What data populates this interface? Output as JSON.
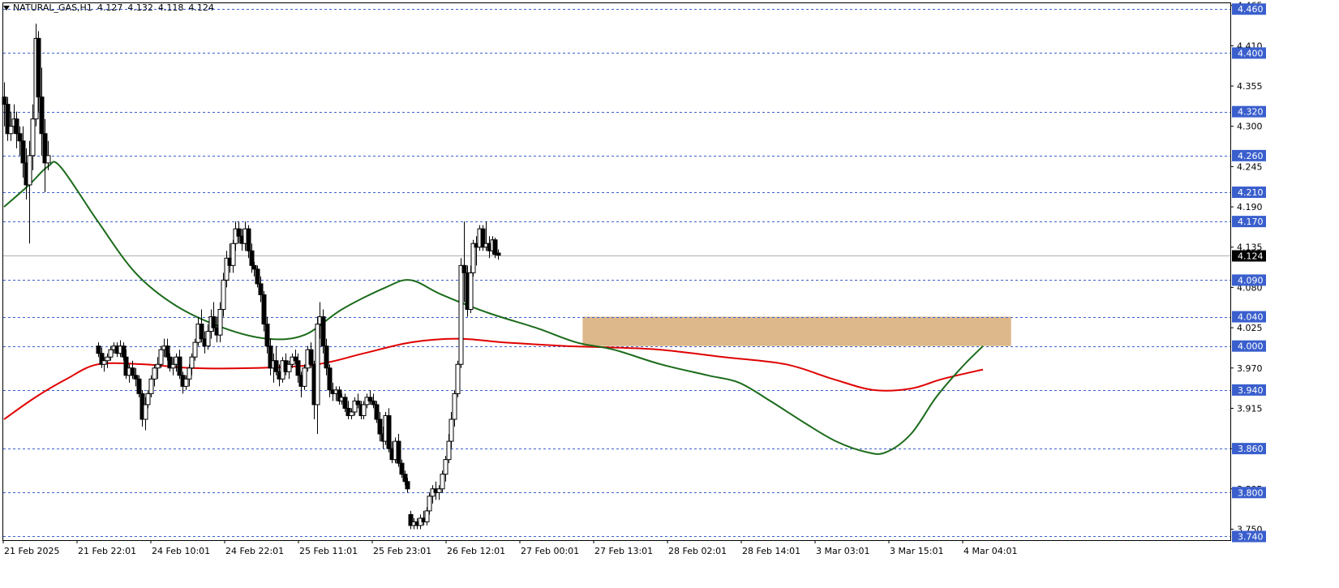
{
  "header": {
    "symbol": "NATURAL_GAS,H1",
    "open": "4.127",
    "high": "4.132",
    "low": "4.118",
    "close": "4.124"
  },
  "colors": {
    "background": "#ffffff",
    "bull": "#ffffff",
    "bear": "#000000",
    "ma_fast": "#1b6b1b",
    "ma_slow": "#e00000",
    "zone": "#dcb88a",
    "level_line": "#3a5fcd",
    "level_label_bg": "#3a5fcd",
    "current_price_bg": "#000000"
  },
  "chart_data": {
    "type": "candlestick",
    "ylim": [
      3.735,
      4.468
    ],
    "grid": false,
    "y_ticks": [
      "4.465",
      "4.410",
      "4.355",
      "4.300",
      "4.245",
      "4.190",
      "4.135",
      "4.080",
      "4.025",
      "3.970",
      "3.915",
      "3.860",
      "3.805",
      "3.750"
    ],
    "x_ticks": [
      "21 Feb 2025",
      "21 Feb 22:01",
      "24 Feb 10:01",
      "24 Feb 22:01",
      "25 Feb 11:01",
      "25 Feb 23:01",
      "26 Feb 12:01",
      "27 Feb 00:01",
      "27 Feb 13:01",
      "28 Feb 02:01",
      "28 Feb 14:01",
      "3 Mar 03:01",
      "3 Mar 15:01",
      "4 Mar 04:01"
    ],
    "levels": [
      {
        "value": 4.46,
        "label": "4.460"
      },
      {
        "value": 4.4,
        "label": "4.400"
      },
      {
        "value": 4.32,
        "label": "4.320"
      },
      {
        "value": 4.26,
        "label": "4.260"
      },
      {
        "value": 4.21,
        "label": "4.210"
      },
      {
        "value": 4.17,
        "label": "4.170"
      },
      {
        "value": 4.09,
        "label": "4.090"
      },
      {
        "value": 4.04,
        "label": "4.040"
      },
      {
        "value": 4.0,
        "label": "4.000"
      },
      {
        "value": 3.94,
        "label": "3.940"
      },
      {
        "value": 3.86,
        "label": "3.860"
      },
      {
        "value": 3.8,
        "label": "3.800"
      },
      {
        "value": 3.74,
        "label": "3.740"
      }
    ],
    "current_price": {
      "value": 4.124,
      "label": "4.124"
    },
    "zone": {
      "from_bar": 185,
      "to_bar": 322,
      "low": 4.0,
      "high": 4.04
    },
    "candles": [
      [
        4.34,
        4.36,
        4.3,
        4.33
      ],
      [
        4.33,
        4.34,
        4.28,
        4.29
      ],
      [
        4.29,
        4.32,
        4.28,
        4.3
      ],
      [
        4.3,
        4.33,
        4.29,
        4.31
      ],
      [
        4.31,
        4.32,
        4.27,
        4.29
      ],
      [
        4.29,
        4.3,
        4.26,
        4.28
      ],
      [
        4.28,
        4.3,
        4.23,
        4.25
      ],
      [
        4.25,
        4.27,
        4.2,
        4.22
      ],
      [
        4.22,
        4.28,
        4.14,
        4.26
      ],
      [
        4.26,
        4.33,
        4.24,
        4.31
      ],
      [
        4.31,
        4.44,
        4.3,
        4.42
      ],
      [
        4.42,
        4.43,
        4.32,
        4.34
      ],
      [
        4.34,
        4.38,
        4.26,
        4.29
      ],
      [
        4.29,
        4.31,
        4.21,
        4.25
      ],
      [
        4.25,
        4.28,
        4.24,
        4.26
      ],
      [
        4.26,
        4.28,
        4.25,
        4.27
      ],
      [
        4.27,
        4.28,
        4.25,
        4.26
      ],
      [
        4.26,
        4.27,
        4.24,
        4.25
      ],
      [
        4.25,
        4.26,
        4.24,
        4.25
      ],
      [
        4.25,
        4.26,
        4.24,
        4.25
      ],
      [
        4.25,
        4.26,
        4.24,
        4.25
      ],
      [
        4.25,
        4.26,
        4.24,
        4.25
      ],
      [
        4.25,
        4.26,
        4.24,
        4.25
      ],
      [
        4.25,
        4.26,
        4.24,
        4.25
      ],
      [
        4.25,
        4.26,
        4.24,
        4.25
      ],
      [
        4.25,
        4.26,
        4.24,
        4.25
      ],
      [
        4.25,
        4.26,
        4.24,
        4.25
      ],
      [
        4.25,
        4.26,
        4.24,
        4.25
      ],
      [
        4.25,
        4.26,
        4.24,
        4.25
      ],
      [
        4.25,
        4.26,
        4.24,
        4.25
      ],
      [
        4.0,
        4.005,
        3.985,
        3.99
      ],
      [
        3.99,
        3.998,
        3.97,
        3.975
      ],
      [
        3.975,
        3.985,
        3.965,
        3.98
      ],
      [
        3.98,
        3.99,
        3.97,
        3.985
      ],
      [
        3.985,
        4.0,
        3.98,
        3.995
      ],
      [
        3.995,
        4.005,
        3.99,
        4.0
      ],
      [
        4.0,
        4.005,
        3.985,
        3.99
      ],
      [
        3.99,
        4.008,
        3.985,
        4.0
      ],
      [
        4.0,
        4.005,
        3.98,
        3.985
      ],
      [
        3.985,
        3.995,
        3.955,
        3.96
      ],
      [
        3.96,
        3.975,
        3.95,
        3.97
      ],
      [
        3.97,
        3.98,
        3.955,
        3.96
      ],
      [
        3.96,
        3.97,
        3.945,
        3.955
      ],
      [
        3.955,
        3.96,
        3.93,
        3.935
      ],
      [
        3.935,
        3.94,
        3.89,
        3.9
      ],
      [
        3.9,
        3.93,
        3.885,
        3.92
      ],
      [
        3.92,
        3.94,
        3.915,
        3.935
      ],
      [
        3.935,
        3.96,
        3.93,
        3.955
      ],
      [
        3.955,
        3.975,
        3.945,
        3.97
      ],
      [
        3.97,
        3.985,
        3.955,
        3.975
      ],
      [
        3.975,
        4.0,
        3.97,
        3.995
      ],
      [
        3.995,
        4.01,
        3.985,
        4.0
      ],
      [
        4.0,
        4.01,
        3.98,
        3.985
      ],
      [
        3.985,
        3.99,
        3.965,
        3.97
      ],
      [
        3.97,
        3.985,
        3.96,
        3.975
      ],
      [
        3.975,
        3.99,
        3.965,
        3.985
      ],
      [
        3.985,
        3.995,
        3.955,
        3.96
      ],
      [
        3.96,
        3.965,
        3.935,
        3.945
      ],
      [
        3.945,
        3.96,
        3.94,
        3.955
      ],
      [
        3.955,
        3.975,
        3.945,
        3.97
      ],
      [
        3.97,
        3.99,
        3.96,
        3.985
      ],
      [
        3.985,
        4.01,
        3.98,
        4.005
      ],
      [
        4.005,
        4.04,
        4.0,
        4.03
      ],
      [
        4.03,
        4.05,
        4.005,
        4.01
      ],
      [
        4.01,
        4.02,
        3.99,
        4.0
      ],
      [
        4.0,
        4.03,
        3.995,
        4.02
      ],
      [
        4.02,
        4.05,
        4.01,
        4.04
      ],
      [
        4.04,
        4.06,
        4.02,
        4.025
      ],
      [
        4.025,
        4.04,
        4.005,
        4.015
      ],
      [
        4.015,
        4.06,
        4.005,
        4.05
      ],
      [
        4.05,
        4.1,
        4.04,
        4.09
      ],
      [
        4.09,
        4.13,
        4.08,
        4.12
      ],
      [
        4.12,
        4.14,
        4.1,
        4.11
      ],
      [
        4.11,
        4.145,
        4.1,
        4.14
      ],
      [
        4.14,
        4.17,
        4.13,
        4.16
      ],
      [
        4.16,
        4.17,
        4.14,
        4.15
      ],
      [
        4.15,
        4.16,
        4.13,
        4.14
      ],
      [
        4.14,
        4.17,
        4.13,
        4.16
      ],
      [
        4.16,
        4.165,
        4.12,
        4.13
      ],
      [
        4.13,
        4.14,
        4.1,
        4.11
      ],
      [
        4.11,
        4.115,
        4.095,
        4.105
      ],
      [
        4.105,
        4.11,
        4.08,
        4.085
      ],
      [
        4.085,
        4.095,
        4.06,
        4.07
      ],
      [
        4.07,
        4.075,
        4.02,
        4.03
      ],
      [
        4.03,
        4.04,
        3.99,
        4.0
      ],
      [
        4.0,
        4.01,
        3.96,
        3.97
      ],
      [
        3.97,
        3.99,
        3.95,
        3.98
      ],
      [
        3.98,
        4.0,
        3.96,
        3.965
      ],
      [
        3.965,
        3.975,
        3.945,
        3.955
      ],
      [
        3.955,
        3.985,
        3.95,
        3.98
      ],
      [
        3.98,
        3.99,
        3.96,
        3.965
      ],
      [
        3.965,
        3.98,
        3.955,
        3.975
      ],
      [
        3.975,
        3.99,
        3.97,
        3.985
      ],
      [
        3.985,
        3.995,
        3.975,
        3.98
      ],
      [
        3.98,
        3.99,
        3.95,
        3.96
      ],
      [
        3.96,
        3.965,
        3.93,
        3.945
      ],
      [
        3.945,
        3.975,
        3.94,
        3.97
      ],
      [
        3.97,
        4.0,
        3.965,
        3.995
      ],
      [
        3.995,
        4.005,
        3.97,
        3.975
      ],
      [
        3.975,
        3.98,
        3.9,
        3.92
      ],
      [
        3.92,
        4.04,
        3.88,
        4.03
      ],
      [
        4.03,
        4.06,
        4.01,
        4.04
      ],
      [
        4.04,
        4.05,
        3.99,
        4.0
      ],
      [
        4.0,
        4.01,
        3.96,
        3.97
      ],
      [
        3.97,
        3.975,
        3.93,
        3.94
      ],
      [
        3.94,
        3.95,
        3.925,
        3.935
      ],
      [
        3.935,
        3.945,
        3.925,
        3.94
      ],
      [
        3.94,
        3.945,
        3.92,
        3.925
      ],
      [
        3.925,
        3.935,
        3.92,
        3.93
      ],
      [
        3.93,
        3.935,
        3.91,
        3.915
      ],
      [
        3.915,
        3.925,
        3.9,
        3.905
      ],
      [
        3.905,
        3.915,
        3.9,
        3.91
      ],
      [
        3.91,
        3.93,
        3.905,
        3.925
      ],
      [
        3.925,
        3.935,
        3.915,
        3.92
      ],
      [
        3.92,
        3.925,
        3.9,
        3.905
      ],
      [
        3.905,
        3.925,
        3.9,
        3.92
      ],
      [
        3.92,
        3.935,
        3.915,
        3.93
      ],
      [
        3.93,
        3.94,
        3.92,
        3.925
      ],
      [
        3.925,
        3.935,
        3.915,
        3.92
      ],
      [
        3.92,
        3.925,
        3.895,
        3.9
      ],
      [
        3.9,
        3.91,
        3.87,
        3.88
      ],
      [
        3.88,
        3.89,
        3.86,
        3.87
      ],
      [
        3.87,
        3.91,
        3.865,
        3.905
      ],
      [
        3.905,
        3.915,
        3.855,
        3.86
      ],
      [
        3.86,
        3.87,
        3.84,
        3.845
      ],
      [
        3.845,
        3.875,
        3.84,
        3.87
      ],
      [
        3.87,
        3.88,
        3.835,
        3.84
      ],
      [
        3.84,
        3.845,
        3.82,
        3.825
      ],
      [
        3.825,
        3.83,
        3.81,
        3.815
      ],
      [
        3.815,
        3.82,
        3.8,
        3.805
      ],
      [
        3.77,
        3.775,
        3.75,
        3.755
      ],
      [
        3.755,
        3.765,
        3.75,
        3.76
      ],
      [
        3.76,
        3.765,
        3.75,
        3.755
      ],
      [
        3.755,
        3.77,
        3.75,
        3.765
      ],
      [
        3.765,
        3.775,
        3.755,
        3.76
      ],
      [
        3.76,
        3.78,
        3.755,
        3.775
      ],
      [
        3.775,
        3.8,
        3.77,
        3.795
      ],
      [
        3.795,
        3.81,
        3.785,
        3.805
      ],
      [
        3.805,
        3.815,
        3.79,
        3.8
      ],
      [
        3.8,
        3.81,
        3.79,
        3.805
      ],
      [
        3.805,
        3.83,
        3.8,
        3.825
      ],
      [
        3.825,
        3.85,
        3.815,
        3.845
      ],
      [
        3.845,
        3.88,
        3.84,
        3.87
      ],
      [
        3.87,
        3.91,
        3.86,
        3.9
      ],
      [
        3.9,
        3.94,
        3.89,
        3.935
      ],
      [
        3.935,
        3.98,
        3.93,
        3.975
      ],
      [
        3.975,
        4.12,
        3.97,
        4.11
      ],
      [
        4.11,
        4.17,
        4.06,
        4.1
      ],
      [
        4.1,
        4.11,
        4.04,
        4.05
      ],
      [
        4.05,
        4.11,
        4.045,
        4.1
      ],
      [
        4.1,
        4.145,
        4.095,
        4.14
      ],
      [
        4.14,
        4.15,
        4.11,
        4.135
      ],
      [
        4.135,
        4.165,
        4.13,
        4.16
      ],
      [
        4.16,
        4.165,
        4.13,
        4.135
      ],
      [
        4.135,
        4.17,
        4.13,
        4.14
      ],
      [
        4.14,
        4.15,
        4.12,
        4.13
      ],
      [
        4.13,
        4.15,
        4.125,
        4.145
      ],
      [
        4.145,
        4.148,
        4.12,
        4.125
      ],
      [
        4.127,
        4.132,
        4.118,
        4.124
      ]
    ],
    "ma_fast": [
      {
        "bar": 0,
        "value": 4.19
      },
      {
        "bar": 8,
        "value": 4.22
      },
      {
        "bar": 14,
        "value": 4.245
      },
      {
        "bar": 18,
        "value": 4.245
      },
      {
        "bar": 30,
        "value": 4.17
      },
      {
        "bar": 42,
        "value": 4.1
      },
      {
        "bar": 55,
        "value": 4.055
      },
      {
        "bar": 70,
        "value": 4.025
      },
      {
        "bar": 84,
        "value": 4.01
      },
      {
        "bar": 96,
        "value": 4.015
      },
      {
        "bar": 108,
        "value": 4.05
      },
      {
        "bar": 122,
        "value": 4.08
      },
      {
        "bar": 130,
        "value": 4.09
      },
      {
        "bar": 140,
        "value": 4.07
      },
      {
        "bar": 155,
        "value": 4.045
      },
      {
        "bar": 170,
        "value": 4.025
      },
      {
        "bar": 183,
        "value": 4.005
      },
      {
        "bar": 195,
        "value": 3.995
      },
      {
        "bar": 210,
        "value": 3.975
      },
      {
        "bar": 225,
        "value": 3.96
      },
      {
        "bar": 235,
        "value": 3.95
      },
      {
        "bar": 245,
        "value": 3.925
      },
      {
        "bar": 256,
        "value": 3.895
      },
      {
        "bar": 266,
        "value": 3.87
      },
      {
        "bar": 276,
        "value": 3.855
      },
      {
        "bar": 282,
        "value": 3.855
      },
      {
        "bar": 290,
        "value": 3.88
      },
      {
        "bar": 298,
        "value": 3.93
      },
      {
        "bar": 306,
        "value": 3.97
      },
      {
        "bar": 313,
        "value": 4.0
      }
    ],
    "ma_slow": [
      {
        "bar": 0,
        "value": 3.9
      },
      {
        "bar": 10,
        "value": 3.93
      },
      {
        "bar": 20,
        "value": 3.955
      },
      {
        "bar": 30,
        "value": 3.975
      },
      {
        "bar": 45,
        "value": 3.975
      },
      {
        "bar": 60,
        "value": 3.97
      },
      {
        "bar": 80,
        "value": 3.97
      },
      {
        "bar": 100,
        "value": 3.975
      },
      {
        "bar": 115,
        "value": 3.99
      },
      {
        "bar": 130,
        "value": 4.005
      },
      {
        "bar": 145,
        "value": 4.01
      },
      {
        "bar": 160,
        "value": 4.005
      },
      {
        "bar": 180,
        "value": 4.0
      },
      {
        "bar": 195,
        "value": 3.998
      },
      {
        "bar": 210,
        "value": 3.995
      },
      {
        "bar": 230,
        "value": 3.985
      },
      {
        "bar": 250,
        "value": 3.975
      },
      {
        "bar": 265,
        "value": 3.955
      },
      {
        "bar": 278,
        "value": 3.94
      },
      {
        "bar": 290,
        "value": 3.942
      },
      {
        "bar": 300,
        "value": 3.955
      },
      {
        "bar": 313,
        "value": 3.968
      }
    ]
  }
}
